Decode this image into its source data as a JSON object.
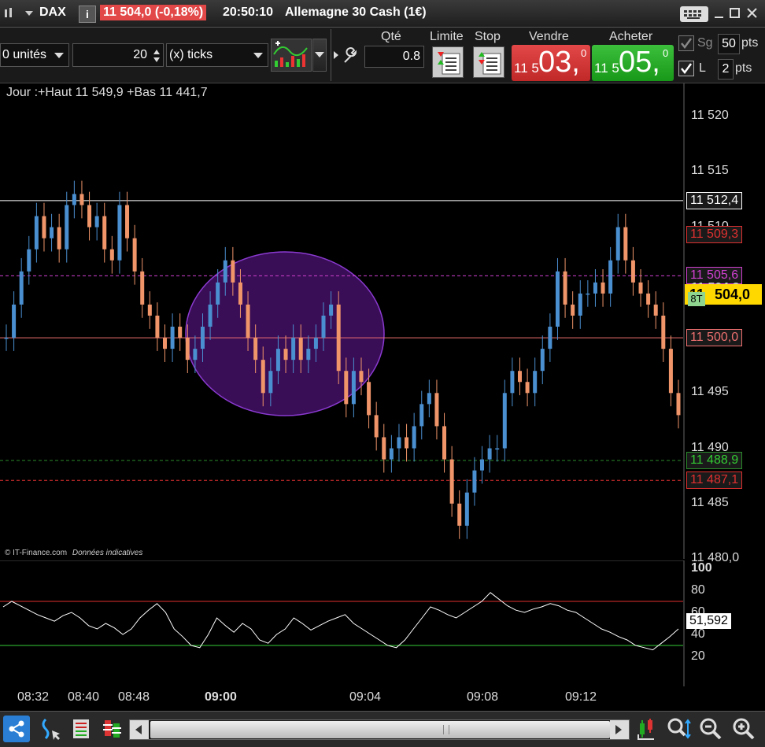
{
  "titlebar": {
    "symbol": "DAX",
    "info_icon": "info-icon",
    "price_change": "11 504,0 (-0,18%)",
    "time": "20:50:10",
    "name": "Allemagne 30 Cash (1€)"
  },
  "toolbar": {
    "units_value": "0 unités",
    "ticks_count": "20",
    "ticks_label": "(x) ticks",
    "qty_label": "Qté",
    "qty_value": "0.8",
    "limit_label": "Limite",
    "stop_label": "Stop",
    "sell_label": "Vendre",
    "sell_small": "11 5",
    "sell_big": "03,",
    "sell_sup": "0",
    "buy_label": "Acheter",
    "buy_small": "11 5",
    "buy_big": "05,",
    "buy_sup": "0",
    "sg_label": "Sg",
    "sg_value": "50",
    "sg_unit": "pts",
    "l_label": "L",
    "l_value": "2",
    "l_unit": "pts"
  },
  "chart": {
    "header": "Jour :+Haut 11 549,9 +Bas 11 441,7",
    "watermark_company": "© IT-Finance.com",
    "watermark_note": "Données indicatives",
    "ellipse_color": "#3a0e56",
    "up_color": "#4a8fd0",
    "down_color": "#f0956a"
  },
  "price_axis": {
    "ticks": [
      {
        "label": "11 520",
        "value": 11520
      },
      {
        "label": "11 515",
        "value": 11515
      },
      {
        "label": "11 510",
        "value": 11510
      },
      {
        "label": "11 495",
        "value": 11495
      },
      {
        "label": "11 490",
        "value": 11490
      },
      {
        "label": "11 485",
        "value": 11485
      },
      {
        "label": "11 480,0",
        "value": 11480
      }
    ],
    "levels": [
      {
        "label": "11 512,4",
        "value": 11512.4,
        "color": "#ffffff",
        "style": "solid"
      },
      {
        "label": "11 509,3",
        "value": 11509.3,
        "color": "#e03030",
        "style": "none"
      },
      {
        "label": "11 505,6",
        "value": 11505.6,
        "color": "#d040d0",
        "style": "dashed"
      },
      {
        "label": "11 500,0",
        "value": 11500.0,
        "color": "#f07070",
        "style": "solid"
      },
      {
        "label": "11 488,9",
        "value": 11488.9,
        "color": "#2a8a2a",
        "style": "dashed"
      },
      {
        "label": "11 487,1",
        "value": 11487.1,
        "color": "#e03030",
        "style": "dashed"
      }
    ],
    "current_hidden": "11 504,2",
    "current_prefix": "11",
    "current_price": "504,0",
    "countdown": "8T"
  },
  "indicator": {
    "ticks": [
      "100",
      "80",
      "60",
      "40",
      "20"
    ],
    "current": "51,592",
    "upper_level": 70,
    "lower_level": 30
  },
  "time_axis": [
    "08:32",
    "08:40",
    "08:48",
    "09:00",
    "09:04",
    "09:08",
    "09:12"
  ],
  "chart_data": {
    "type": "line",
    "title": "",
    "ylim": [
      11480,
      11523
    ],
    "close_series": [
      11500,
      11503,
      11506,
      11508,
      11511,
      11509,
      11510,
      11508,
      11512,
      11513,
      11512,
      11510,
      11511,
      11508,
      11507,
      11512,
      11509,
      11506,
      11503,
      11502,
      11500,
      11499,
      11501,
      11500,
      11498,
      11499,
      11501,
      11503,
      11505,
      11507,
      11505,
      11503,
      11500,
      11498,
      11495,
      11497,
      11499,
      11498,
      11500,
      11498,
      11499,
      11500,
      11502,
      11503,
      11497,
      11494,
      11497,
      11496,
      11493,
      11491,
      11489,
      11490,
      11491,
      11490,
      11492,
      11494,
      11495,
      11492,
      11489,
      11485,
      11483,
      11486,
      11488,
      11489,
      11490,
      11490,
      11495,
      11497,
      11496,
      11495,
      11497,
      11499,
      11501,
      11506,
      11503,
      11502,
      11504,
      11504,
      11505,
      11504,
      11507,
      11510,
      11507,
      11505,
      11504,
      11503,
      11502,
      11499,
      11495,
      11493
    ],
    "rsi_series": [
      65,
      70,
      66,
      62,
      58,
      55,
      52,
      57,
      60,
      55,
      48,
      45,
      50,
      46,
      40,
      45,
      55,
      62,
      68,
      60,
      45,
      38,
      30,
      28,
      40,
      55,
      48,
      42,
      50,
      45,
      35,
      32,
      40,
      45,
      55,
      50,
      44,
      48,
      52,
      55,
      58,
      50,
      45,
      40,
      35,
      30,
      28,
      35,
      45,
      55,
      65,
      62,
      58,
      55,
      60,
      65,
      70,
      78,
      72,
      66,
      62,
      60,
      63,
      65,
      68,
      66,
      62,
      60,
      55,
      50,
      45,
      42,
      38,
      35,
      30,
      28,
      26,
      32,
      38,
      45
    ],
    "levels": [
      11512.4,
      11509.3,
      11505.6,
      11500.0,
      11488.9,
      11487.1
    ]
  },
  "bottombar": {
    "icons": [
      "share-icon",
      "cursor-icon",
      "drawing-tools-icon",
      "indicator-icon",
      "scroll-left-icon",
      "scroll-right-icon",
      "candle-style-icon",
      "zoom-fit-icon",
      "zoom-out-icon",
      "zoom-in-icon"
    ]
  }
}
